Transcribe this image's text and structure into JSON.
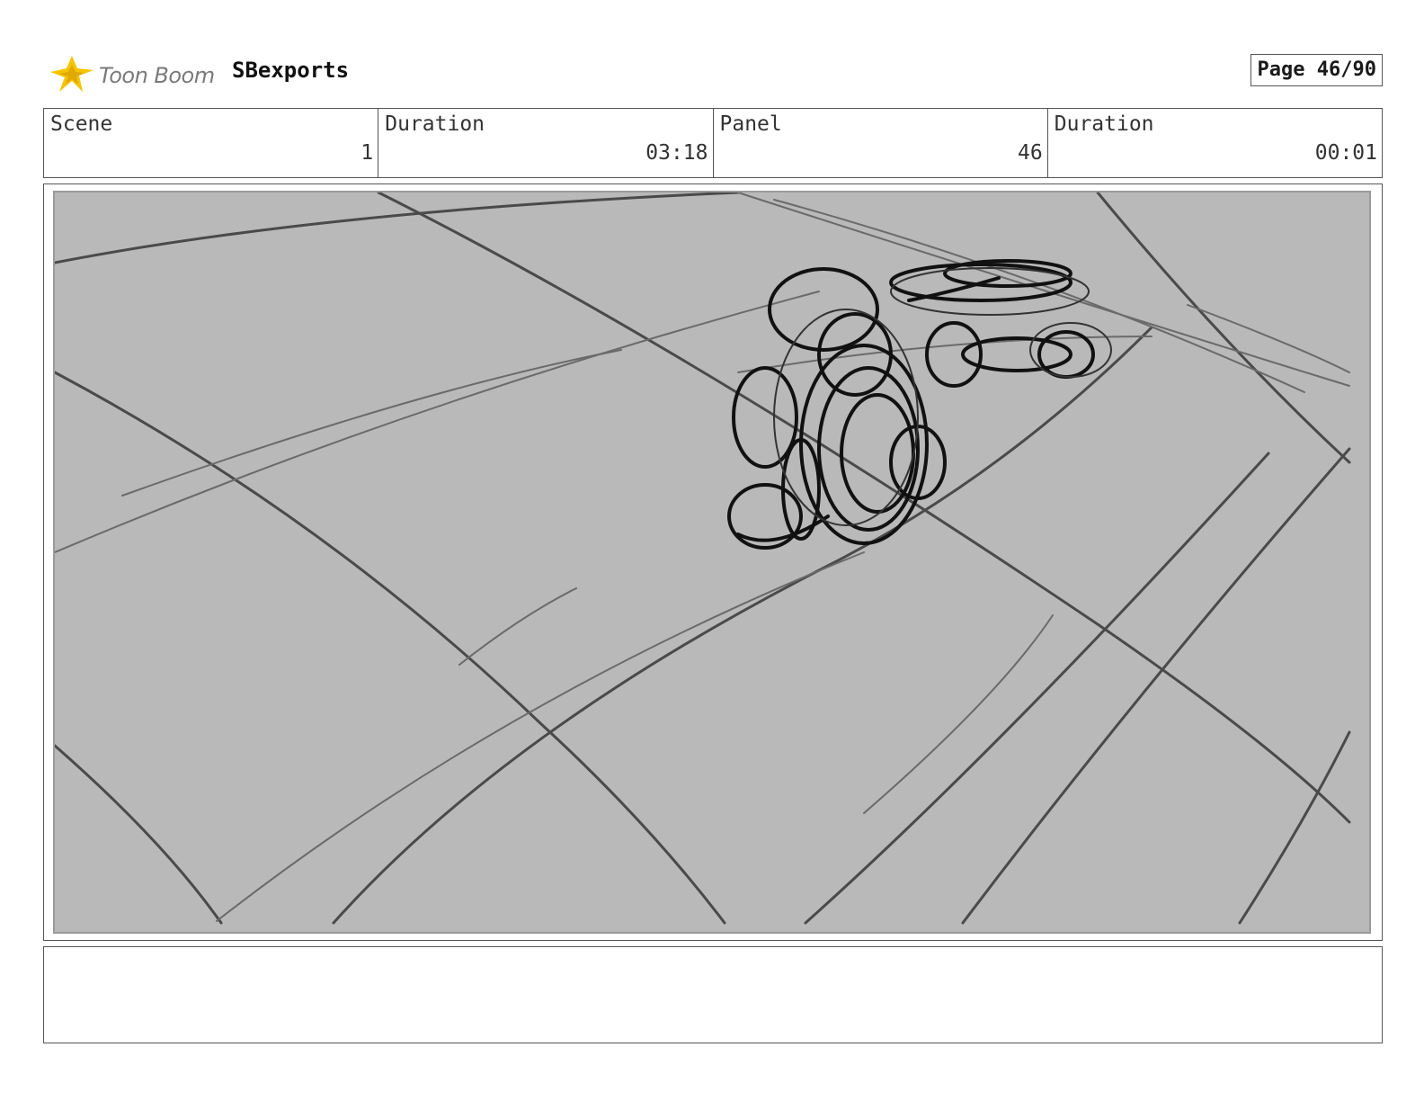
{
  "header": {
    "logo_text": "Toon Boom",
    "project_name": "SBexports",
    "page_label": "Page 46/90"
  },
  "info": {
    "scene_label": "Scene",
    "scene_value": "1",
    "scene_duration_label": "Duration",
    "scene_duration_value": "03:18",
    "panel_label": "Panel",
    "panel_value": "46",
    "panel_duration_label": "Duration",
    "panel_duration_value": "00:01"
  },
  "colors": {
    "panel_background": "#b9b9b9",
    "logo_accent": "#f5c400",
    "sketch_ink": "#111111"
  },
  "icons": [
    "toon-boom-logo-icon"
  ]
}
